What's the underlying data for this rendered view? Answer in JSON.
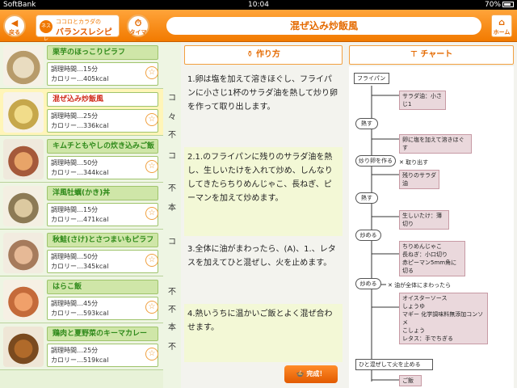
{
  "status_bar": {
    "carrier": "SoftBank",
    "time": "10:04",
    "battery": "70%"
  },
  "header": {
    "back_label": "戻る",
    "logo_top": "ココロとカラダの",
    "logo_main": "バランスレシピ",
    "logo_brand": "ネスレ",
    "timer_label": "タイマー",
    "title": "混ぜ込み炒飯風",
    "home_label": "ホーム"
  },
  "recipes": [
    {
      "name": "栗芋のほっこりピラフ",
      "time": "調理時間…15分",
      "kcal": "カロリー…405kcal"
    },
    {
      "name": "混ぜ込み炒飯風",
      "time": "調理時間…25分",
      "kcal": "カロリー…336kcal"
    },
    {
      "name": "キムチともやしの炊き込みご飯",
      "time": "調理時間…50分",
      "kcal": "カロリー…344kcal"
    },
    {
      "name": "洋風牡蠣(かき)丼",
      "time": "調理時間…15分",
      "kcal": "カロリー…471kcal"
    },
    {
      "name": "秋鮭(さけ)とさつまいもピラフ",
      "time": "調理時間…50分",
      "kcal": "カロリー…345kcal"
    },
    {
      "name": "はらこ飯",
      "time": "調理時間…45分",
      "kcal": "カロリー…593kcal"
    },
    {
      "name": "鶏肉と夏野菜のキーマカレー",
      "time": "調理時間…25分",
      "kcal": "カロリー…519kcal"
    }
  ],
  "strip": [
    "コ",
    "々",
    "不",
    "コ",
    "不",
    "本",
    "コ",
    "不",
    "不",
    "本",
    "不"
  ],
  "method": {
    "heading": "作り方",
    "steps": [
      "1.卵は塩を加えて溶きほぐし、フライパンに小さじ1杯のサラダ油を熱して炒り卵を作って取り出します。",
      "2.1.のフライパンに残りのサラダ油を熱し、生しいたけを入れて炒め、しんなりしてきたらちりめんじゃこ、長ねぎ、ピーマンを加えて炒めます。",
      "3.全体に油がまわったら、(A)、1.、レタスを加えてひと混ぜし、火を止めます。",
      "4.熱いうちに温かいご飯とよく混ぜ合わせます。"
    ],
    "done_label": "完成！"
  },
  "chart": {
    "heading": "チャート",
    "nodes": {
      "pan": "フライパン",
      "oil_small": "サラダ油：小さじ1",
      "heat1": "熱す",
      "egg_salt": "卵に塩を加えて溶きほぐす",
      "make_egg": "炒り卵を作る",
      "take_out": "✕ 取り出す",
      "oil_rest": "残りのサラダ油",
      "heat2": "熱す",
      "shiitake": "生しいたけ：薄切り",
      "stirfry": "炒める",
      "veg": "ちりめんじゃこ\n長ねぎ：小口切り\n赤ピーマン5mm角に切る",
      "stirfry2": "炒める",
      "oil_note": "✕ 油が全体にまわったら",
      "sauce": "オイスターソース\nしょうゆ\nマギー 化学調味料無添加コンソメ\nこしょう\nレタス：手でちぎる",
      "mix_off": "ひと混ぜして火を止める",
      "rice": "ご飯"
    }
  },
  "colors": {
    "accent": "#f27a00",
    "list_bg": "#e8f2d8",
    "selected": "#fff5b8"
  }
}
